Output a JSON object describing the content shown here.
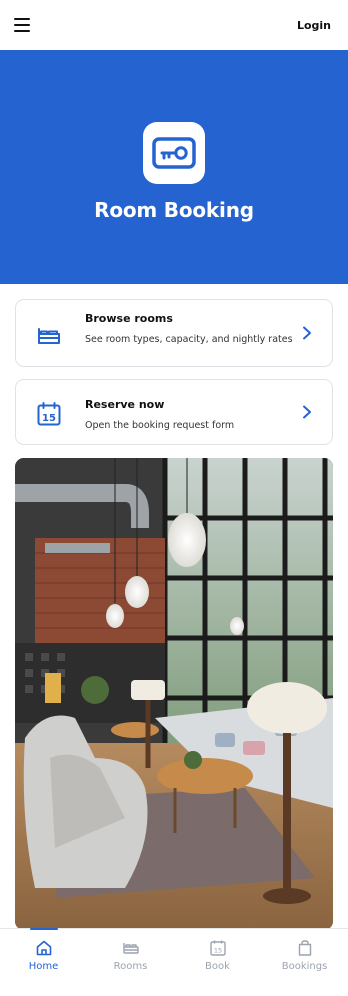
{
  "header": {
    "login_label": "Login",
    "menu_icon": "hamburger-menu-icon"
  },
  "hero": {
    "title": "Room Booking",
    "logo_icon": "key-card-icon",
    "background_color": "#2563d1"
  },
  "cards": [
    {
      "title": "Browse rooms",
      "subtitle": "See room types, capacity, and nightly rates",
      "icon": "bed-icon",
      "action_icon": "chevron-right-icon"
    },
    {
      "title": "Reserve now",
      "subtitle": "Open the booking request form",
      "icon": "calendar-15-icon",
      "calendar_day": "15",
      "action_icon": "chevron-right-icon"
    }
  ],
  "photo": {
    "subject": "hotel-lounge-photo"
  },
  "tabs": [
    {
      "label": "Home",
      "icon": "home-icon",
      "active": true
    },
    {
      "label": "Rooms",
      "icon": "bed-icon",
      "active": false
    },
    {
      "label": "Book",
      "icon": "calendar-15-icon",
      "calendar_day": "15",
      "active": false
    },
    {
      "label": "Bookings",
      "icon": "bag-icon",
      "active": false
    }
  ],
  "colors": {
    "accent": "#2563d1",
    "inactive": "#9ca3af"
  }
}
